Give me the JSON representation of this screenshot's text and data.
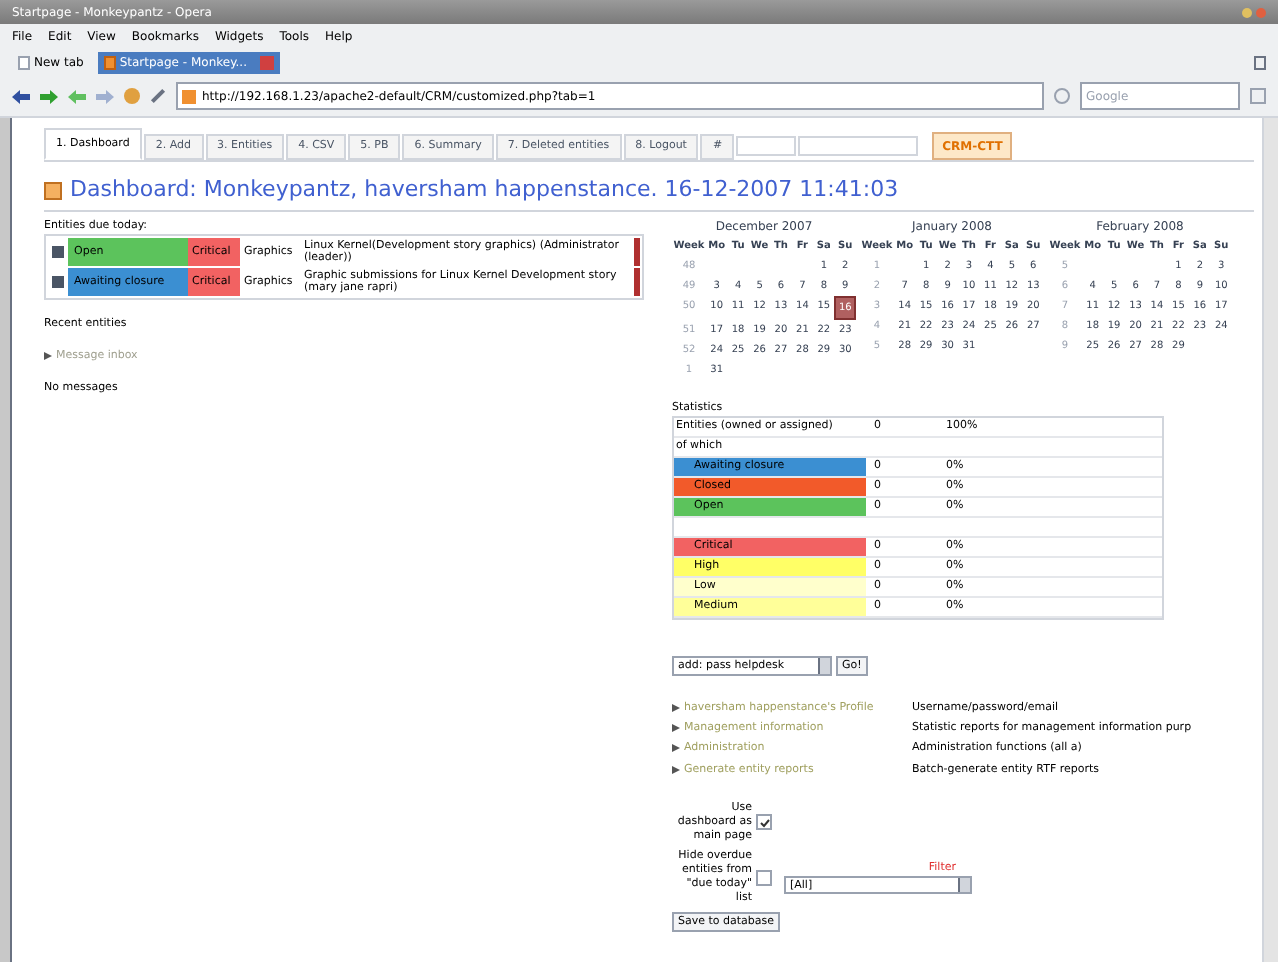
{
  "browser": {
    "title": "Startpage - Monkeypantz - Opera",
    "menu": [
      "File",
      "Edit",
      "View",
      "Bookmarks",
      "Widgets",
      "Tools",
      "Help"
    ],
    "tabs": [
      {
        "label": "New tab",
        "selected": false
      },
      {
        "label": "Startpage - Monkey...",
        "selected": true
      }
    ],
    "address": "http://192.168.1.23/apache2-default/CRM/customized.php?tab=1",
    "search": {
      "placeholder": "Google"
    }
  },
  "page_tabs": [
    {
      "label": "1. Dashboard",
      "selected": true
    },
    {
      "label": "2. Add",
      "selected": false
    },
    {
      "label": "3. Entities",
      "selected": false
    },
    {
      "label": "4. CSV",
      "selected": false
    },
    {
      "label": "5. PB",
      "selected": false
    },
    {
      "label": "6. Summary",
      "selected": false
    },
    {
      "label": "7. Deleted entities",
      "selected": false
    },
    {
      "label": "8. Logout",
      "selected": false
    },
    {
      "label": "#",
      "selected": false
    }
  ],
  "logo": "CRM-CTT",
  "heading": "Dashboard: Monkeypantz, haversham happenstance. 16-12-2007 11:41:03",
  "due_today": {
    "title": "Entities due today:",
    "rows": [
      {
        "status": {
          "label": "Open",
          "color": "#5cc35c"
        },
        "priority": {
          "label": "Critical",
          "color": "#f26262"
        },
        "category": "Graphics",
        "description": "Linux Kernel(Development story graphics) (Administrator (leader))"
      },
      {
        "status": {
          "label": "Awaiting closure",
          "color": "#3b8fd2"
        },
        "priority": {
          "label": "Critical",
          "color": "#f26262"
        },
        "category": "Graphics",
        "description": "Graphic submissions for Linux Kernel Development story (mary jane rapri)"
      }
    ]
  },
  "recent": {
    "title": "Recent entities",
    "inbox": "Message inbox",
    "empty": "No messages"
  },
  "calendars": [
    {
      "title": "December 2007",
      "headers": [
        "Week",
        "Mo",
        "Tu",
        "We",
        "Th",
        "Fr",
        "Sa",
        "Su"
      ],
      "rows": [
        {
          "week": "48",
          "days": [
            {
              "kind": "empty"
            },
            {
              "kind": "empty"
            },
            {
              "kind": "empty"
            },
            {
              "kind": "empty"
            },
            {
              "kind": "empty"
            },
            {
              "kind": "day",
              "t": "1",
              "selected": false
            },
            {
              "kind": "day",
              "t": "2",
              "selected": false
            }
          ]
        },
        {
          "week": "49",
          "days": [
            {
              "kind": "day",
              "t": "3",
              "selected": false
            },
            {
              "kind": "day",
              "t": "4",
              "selected": false
            },
            {
              "kind": "day",
              "t": "5",
              "selected": false
            },
            {
              "kind": "day",
              "t": "6",
              "selected": false
            },
            {
              "kind": "day",
              "t": "7",
              "selected": false
            },
            {
              "kind": "day",
              "t": "8",
              "selected": false
            },
            {
              "kind": "day",
              "t": "9",
              "selected": false
            }
          ]
        },
        {
          "week": "50",
          "days": [
            {
              "kind": "day",
              "t": "10",
              "selected": false
            },
            {
              "kind": "day",
              "t": "11",
              "selected": false
            },
            {
              "kind": "day",
              "t": "12",
              "selected": false
            },
            {
              "kind": "day",
              "t": "13",
              "selected": false
            },
            {
              "kind": "day",
              "t": "14",
              "selected": false
            },
            {
              "kind": "day",
              "t": "15",
              "selected": false
            },
            {
              "kind": "day",
              "t": "16",
              "selected": true
            }
          ]
        },
        {
          "week": "51",
          "days": [
            {
              "kind": "day",
              "t": "17",
              "selected": false
            },
            {
              "kind": "day",
              "t": "18",
              "selected": false
            },
            {
              "kind": "day",
              "t": "19",
              "selected": false
            },
            {
              "kind": "day",
              "t": "20",
              "selected": false
            },
            {
              "kind": "day",
              "t": "21",
              "selected": false
            },
            {
              "kind": "day",
              "t": "22",
              "selected": false
            },
            {
              "kind": "day",
              "t": "23",
              "selected": false
            }
          ]
        },
        {
          "week": "52",
          "days": [
            {
              "kind": "day",
              "t": "24",
              "selected": false
            },
            {
              "kind": "day",
              "t": "25",
              "selected": false
            },
            {
              "kind": "day",
              "t": "26",
              "selected": false
            },
            {
              "kind": "day",
              "t": "27",
              "selected": false
            },
            {
              "kind": "day",
              "t": "28",
              "selected": false
            },
            {
              "kind": "day",
              "t": "29",
              "selected": false
            },
            {
              "kind": "day",
              "t": "30",
              "selected": false
            }
          ]
        },
        {
          "week": "1",
          "days": [
            {
              "kind": "day",
              "t": "31",
              "selected": false
            }
          ]
        }
      ]
    },
    {
      "title": "January 2008",
      "headers": [
        "Week",
        "Mo",
        "Tu",
        "We",
        "Th",
        "Fr",
        "Sa",
        "Su"
      ],
      "rows": [
        {
          "week": "1",
          "days": [
            {
              "kind": "empty"
            },
            {
              "kind": "day",
              "t": "1",
              "selected": false
            },
            {
              "kind": "day",
              "t": "2",
              "selected": false
            },
            {
              "kind": "day",
              "t": "3",
              "selected": false
            },
            {
              "kind": "day",
              "t": "4",
              "selected": false
            },
            {
              "kind": "day",
              "t": "5",
              "selected": false
            },
            {
              "kind": "day",
              "t": "6",
              "selected": false
            }
          ]
        },
        {
          "week": "2",
          "days": [
            {
              "kind": "day",
              "t": "7",
              "selected": false
            },
            {
              "kind": "day",
              "t": "8",
              "selected": false
            },
            {
              "kind": "day",
              "t": "9",
              "selected": false
            },
            {
              "kind": "day",
              "t": "10",
              "selected": false
            },
            {
              "kind": "day",
              "t": "11",
              "selected": false
            },
            {
              "kind": "day",
              "t": "12",
              "selected": false
            },
            {
              "kind": "day",
              "t": "13",
              "selected": false
            }
          ]
        },
        {
          "week": "3",
          "days": [
            {
              "kind": "day",
              "t": "14",
              "selected": false
            },
            {
              "kind": "day",
              "t": "15",
              "selected": false
            },
            {
              "kind": "day",
              "t": "16",
              "selected": false
            },
            {
              "kind": "day",
              "t": "17",
              "selected": false
            },
            {
              "kind": "day",
              "t": "18",
              "selected": false
            },
            {
              "kind": "day",
              "t": "19",
              "selected": false
            },
            {
              "kind": "day",
              "t": "20",
              "selected": false
            }
          ]
        },
        {
          "week": "4",
          "days": [
            {
              "kind": "day",
              "t": "21",
              "selected": false
            },
            {
              "kind": "day",
              "t": "22",
              "selected": false
            },
            {
              "kind": "day",
              "t": "23",
              "selected": false
            },
            {
              "kind": "day",
              "t": "24",
              "selected": false
            },
            {
              "kind": "day",
              "t": "25",
              "selected": false
            },
            {
              "kind": "day",
              "t": "26",
              "selected": false
            },
            {
              "kind": "day",
              "t": "27",
              "selected": false
            }
          ]
        },
        {
          "week": "5",
          "days": [
            {
              "kind": "day",
              "t": "28",
              "selected": false
            },
            {
              "kind": "day",
              "t": "29",
              "selected": false
            },
            {
              "kind": "day",
              "t": "30",
              "selected": false
            },
            {
              "kind": "day",
              "t": "31",
              "selected": false
            }
          ]
        }
      ]
    },
    {
      "title": "February 2008",
      "headers": [
        "Week",
        "Mo",
        "Tu",
        "We",
        "Th",
        "Fr",
        "Sa",
        "Su"
      ],
      "rows": [
        {
          "week": "5",
          "days": [
            {
              "kind": "empty"
            },
            {
              "kind": "empty"
            },
            {
              "kind": "empty"
            },
            {
              "kind": "empty"
            },
            {
              "kind": "day",
              "t": "1",
              "selected": false
            },
            {
              "kind": "day",
              "t": "2",
              "selected": false
            },
            {
              "kind": "day",
              "t": "3",
              "selected": false
            }
          ]
        },
        {
          "week": "6",
          "days": [
            {
              "kind": "day",
              "t": "4",
              "selected": false
            },
            {
              "kind": "day",
              "t": "5",
              "selected": false
            },
            {
              "kind": "day",
              "t": "6",
              "selected": false
            },
            {
              "kind": "day",
              "t": "7",
              "selected": false
            },
            {
              "kind": "day",
              "t": "8",
              "selected": false
            },
            {
              "kind": "day",
              "t": "9",
              "selected": false
            },
            {
              "kind": "day",
              "t": "10",
              "selected": false
            }
          ]
        },
        {
          "week": "7",
          "days": [
            {
              "kind": "day",
              "t": "11",
              "selected": false
            },
            {
              "kind": "day",
              "t": "12",
              "selected": false
            },
            {
              "kind": "day",
              "t": "13",
              "selected": false
            },
            {
              "kind": "day",
              "t": "14",
              "selected": false
            },
            {
              "kind": "day",
              "t": "15",
              "selected": false
            },
            {
              "kind": "day",
              "t": "16",
              "selected": false
            },
            {
              "kind": "day",
              "t": "17",
              "selected": false
            }
          ]
        },
        {
          "week": "8",
          "days": [
            {
              "kind": "day",
              "t": "18",
              "selected": false
            },
            {
              "kind": "day",
              "t": "19",
              "selected": false
            },
            {
              "kind": "day",
              "t": "20",
              "selected": false
            },
            {
              "kind": "day",
              "t": "21",
              "selected": false
            },
            {
              "kind": "day",
              "t": "22",
              "selected": false
            },
            {
              "kind": "day",
              "t": "23",
              "selected": false
            },
            {
              "kind": "day",
              "t": "24",
              "selected": false
            }
          ]
        },
        {
          "week": "9",
          "days": [
            {
              "kind": "day",
              "t": "25",
              "selected": false
            },
            {
              "kind": "day",
              "t": "26",
              "selected": false
            },
            {
              "kind": "day",
              "t": "27",
              "selected": false
            },
            {
              "kind": "day",
              "t": "28",
              "selected": false
            },
            {
              "kind": "day",
              "t": "29",
              "selected": false
            }
          ]
        }
      ]
    }
  ],
  "statistics": {
    "title": "Statistics",
    "total": {
      "label": "Entities (owned or assigned)",
      "count": "0",
      "percent": "100%"
    },
    "of_which": "of which",
    "status_rows": [
      {
        "label": "Awaiting closure",
        "color": "#3b8fd2",
        "count": "0",
        "percent": "0%"
      },
      {
        "label": "Closed",
        "color": "#f25a2a",
        "count": "0",
        "percent": "0%"
      },
      {
        "label": "Open",
        "color": "#5cc35c",
        "count": "0",
        "percent": "0%"
      }
    ],
    "priority_rows": [
      {
        "label": "Critical",
        "color": "#f26262",
        "count": "0",
        "percent": "0%"
      },
      {
        "label": "High",
        "color": "#ffff66",
        "count": "0",
        "percent": "0%"
      },
      {
        "label": "Low",
        "color": "#ffffcc",
        "count": "0",
        "percent": "0%"
      },
      {
        "label": "Medium",
        "color": "#ffff99",
        "count": "0",
        "percent": "0%"
      }
    ]
  },
  "add_select": {
    "value": "add: pass helpdesk",
    "button": "Go!"
  },
  "links": [
    {
      "label": "haversham happenstance's Profile",
      "description": "Username/password/email"
    },
    {
      "label": "Management information",
      "description": "Statistic reports for management information purp"
    },
    {
      "label": "Administration",
      "description": "Administration functions (all a)"
    },
    {
      "label": "Generate entity reports",
      "description": "Batch-generate entity RTF reports"
    }
  ],
  "settings": {
    "checkboxes": [
      {
        "label": "Use dashboard as main page",
        "checked": true
      },
      {
        "label": "Hide overdue entities from \"due today\" list",
        "checked": false
      }
    ],
    "filter_label": "Filter",
    "filter_value": "[All]",
    "save": "Save to database"
  }
}
